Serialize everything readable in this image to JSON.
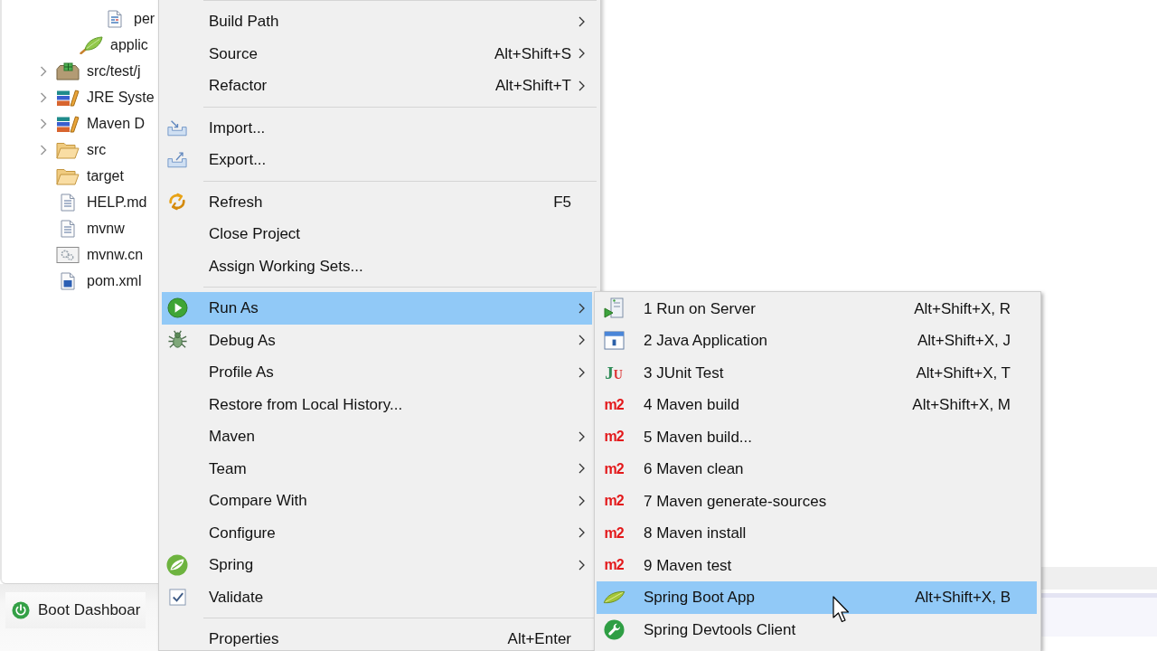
{
  "project_explorer": {
    "items": [
      {
        "children": [
          {
            "children": [
              {
                "kind": "page",
                "label": "per"
              }
            ]
          },
          {
            "kind": "leaf",
            "label": "applic"
          }
        ]
      },
      {
        "kind": "package-folder",
        "label": "src/test/j",
        "expanded": false
      },
      {
        "kind": "library",
        "label": "JRE Syste",
        "expanded": false
      },
      {
        "kind": "library",
        "label": "Maven D",
        "expanded": false
      },
      {
        "kind": "folder",
        "label": "src",
        "expanded": false
      },
      {
        "kind": "folder",
        "label": "target"
      },
      {
        "kind": "file",
        "label": "HELP.md"
      },
      {
        "kind": "file",
        "label": "mvnw"
      },
      {
        "kind": "gear-file",
        "label": "mvnw.cn"
      },
      {
        "kind": "pom-file",
        "label": "pom.xml"
      }
    ]
  },
  "bottom_panel": {
    "tabs": [
      {
        "label": "Boot Dashboar"
      }
    ]
  },
  "context_menu": {
    "items": [
      {
        "kind": "separator"
      },
      {
        "kind": "plain",
        "label": "Build Path",
        "submenu": true,
        "selected": false
      },
      {
        "kind": "plain",
        "label": "Source",
        "shortcut": "Alt+Shift+S",
        "submenu": true,
        "selected": false
      },
      {
        "kind": "plain",
        "label": "Refactor",
        "shortcut": "Alt+Shift+T",
        "submenu": true,
        "selected": false
      },
      {
        "kind": "separator"
      },
      {
        "kind": "import",
        "label": "Import...",
        "submenu": false,
        "selected": false
      },
      {
        "kind": "export",
        "label": "Export...",
        "submenu": false,
        "selected": false
      },
      {
        "kind": "separator"
      },
      {
        "kind": "refresh",
        "label": "Refresh",
        "shortcut": "F5",
        "submenu": false,
        "selected": false
      },
      {
        "kind": "plain",
        "label": "Close Project",
        "submenu": false,
        "selected": false
      },
      {
        "kind": "plain",
        "label": "Assign Working Sets...",
        "submenu": false,
        "selected": false
      },
      {
        "kind": "separator"
      },
      {
        "kind": "run",
        "label": "Run As",
        "submenu": true,
        "selected": true
      },
      {
        "kind": "debug",
        "label": "Debug As",
        "submenu": true,
        "selected": false
      },
      {
        "kind": "plain",
        "label": "Profile As",
        "submenu": true,
        "selected": false
      },
      {
        "kind": "plain",
        "label": "Restore from Local History...",
        "submenu": false,
        "selected": false
      },
      {
        "kind": "plain",
        "label": "Maven",
        "submenu": true,
        "selected": false
      },
      {
        "kind": "plain",
        "label": "Team",
        "submenu": true,
        "selected": false
      },
      {
        "kind": "plain",
        "label": "Compare With",
        "submenu": true,
        "selected": false
      },
      {
        "kind": "plain",
        "label": "Configure",
        "submenu": true,
        "selected": false
      },
      {
        "kind": "spring",
        "label": "Spring",
        "submenu": true,
        "selected": false
      },
      {
        "kind": "check",
        "label": "Validate",
        "checked": true,
        "submenu": false,
        "selected": false
      },
      {
        "kind": "separator"
      },
      {
        "kind": "plain",
        "label": "Properties",
        "shortcut": "Alt+Enter",
        "submenu": false,
        "selected": false
      }
    ]
  },
  "run_as_submenu": {
    "items": [
      {
        "kind": "server",
        "label": "1 Run on Server",
        "shortcut": "Alt+Shift+X, R",
        "selected": false
      },
      {
        "kind": "java",
        "label": "2 Java Application",
        "shortcut": "Alt+Shift+X, J",
        "selected": false
      },
      {
        "kind": "junit",
        "icon_text": "JU",
        "label": "3 JUnit Test",
        "shortcut": "Alt+Shift+X, T",
        "selected": false
      },
      {
        "kind": "maven",
        "icon_text": "m2",
        "label": "4 Maven build",
        "shortcut": "Alt+Shift+X, M",
        "selected": false
      },
      {
        "kind": "maven",
        "icon_text": "m2",
        "label": "5 Maven build...",
        "selected": false
      },
      {
        "kind": "maven",
        "icon_text": "m2",
        "label": "6 Maven clean",
        "selected": false
      },
      {
        "kind": "maven",
        "icon_text": "m2",
        "label": "7 Maven generate-sources",
        "selected": false
      },
      {
        "kind": "maven",
        "icon_text": "m2",
        "label": "8 Maven install",
        "selected": false
      },
      {
        "kind": "maven",
        "icon_text": "m2",
        "label": "9 Maven test",
        "selected": false
      },
      {
        "kind": "spring-boot",
        "label": "Spring Boot App",
        "shortcut": "Alt+Shift+X, B",
        "selected": true
      },
      {
        "kind": "devtools",
        "label": "Spring Devtools Client",
        "selected": false
      }
    ]
  }
}
